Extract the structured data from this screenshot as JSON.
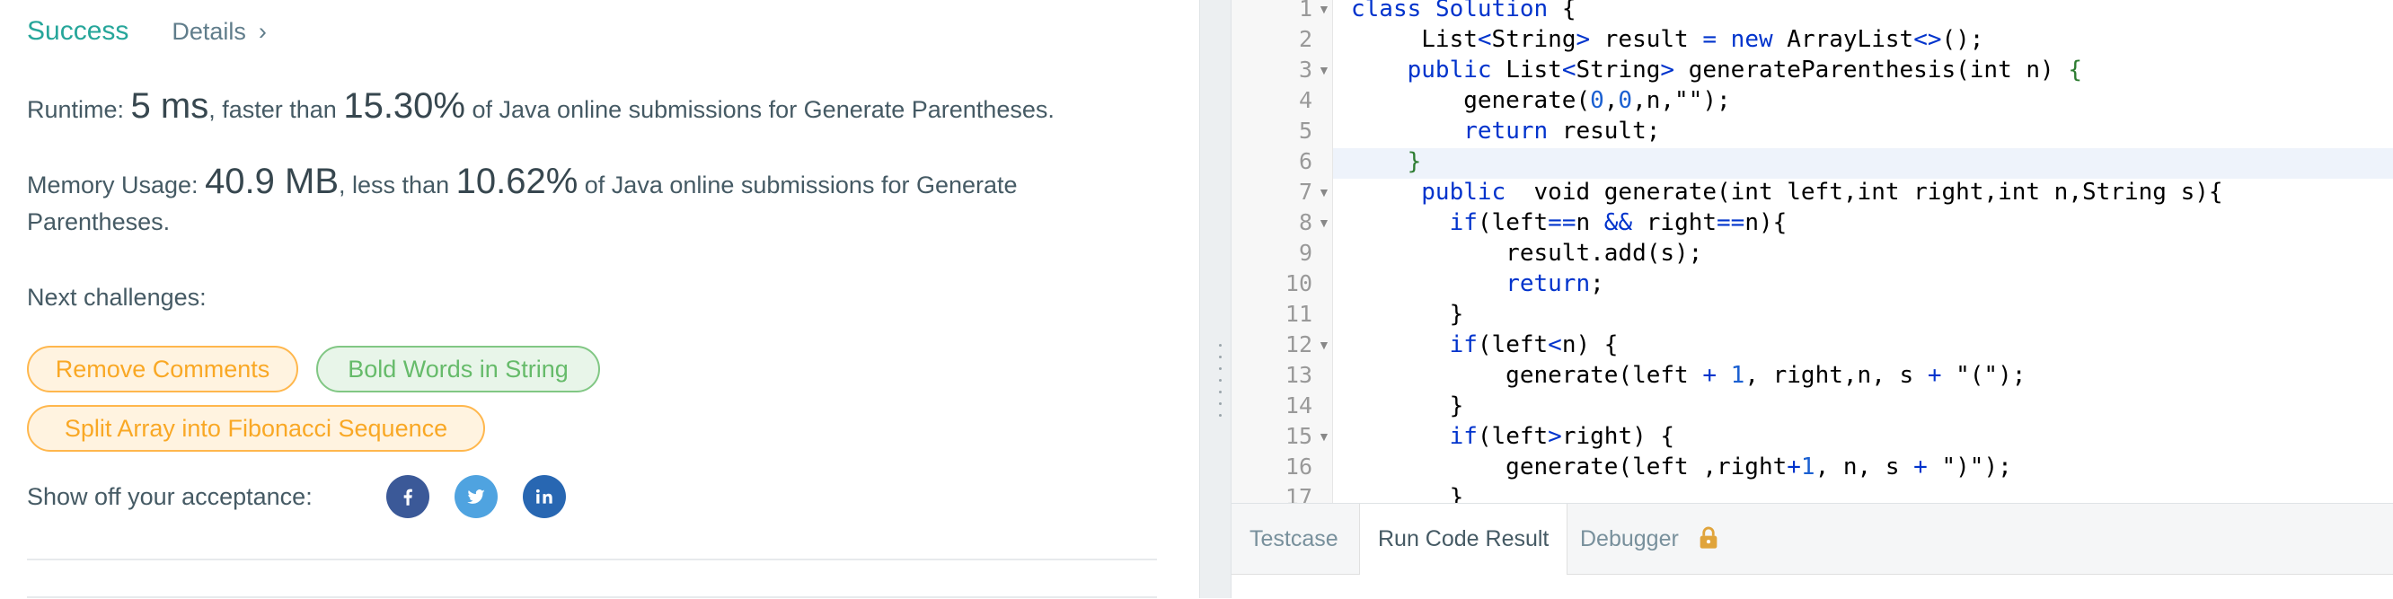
{
  "result": {
    "status": "Success",
    "details_label": "Details",
    "runtime_prefix": "Runtime: ",
    "runtime_value": "5 ms",
    "runtime_mid": ", faster than ",
    "runtime_percent": "15.30%",
    "runtime_suffix": " of Java online submissions for Generate Parentheses.",
    "memory_prefix": "Memory Usage: ",
    "memory_value": "40.9 MB",
    "memory_mid": ", less than ",
    "memory_percent": "10.62%",
    "memory_suffix": " of Java online submissions for Generate",
    "memory_suffix2": "Parentheses.",
    "next_challenges_label": "Next challenges:",
    "challenges": [
      {
        "label": "Remove Comments",
        "difficulty": "hard"
      },
      {
        "label": "Bold Words in String",
        "difficulty": "easy"
      },
      {
        "label": "Split Array into Fibonacci Sequence",
        "difficulty": "medium"
      }
    ],
    "share_label": "Show off your acceptance:",
    "share_icons": [
      "facebook-icon",
      "twitter-icon",
      "linkedin-icon"
    ]
  },
  "editor": {
    "line_numbers": [
      "1",
      "2",
      "3",
      "4",
      "5",
      "6",
      "7",
      "8",
      "9",
      "10",
      "11",
      "12",
      "13",
      "14",
      "15",
      "16",
      "17"
    ],
    "fold_lines": [
      "1",
      "3",
      "7",
      "8",
      "12",
      "15"
    ],
    "active_line": "6"
  },
  "bottom_tabs": {
    "testcase": "Testcase",
    "run_code_result": "Run Code Result",
    "debugger": "Debugger",
    "active": "Run Code Result"
  },
  "colors": {
    "success": "#26a69a",
    "keyword": "#0033cc",
    "hard_pill": "#f9a825",
    "easy_pill": "#66bb6a",
    "lock": "#e0a43b"
  }
}
